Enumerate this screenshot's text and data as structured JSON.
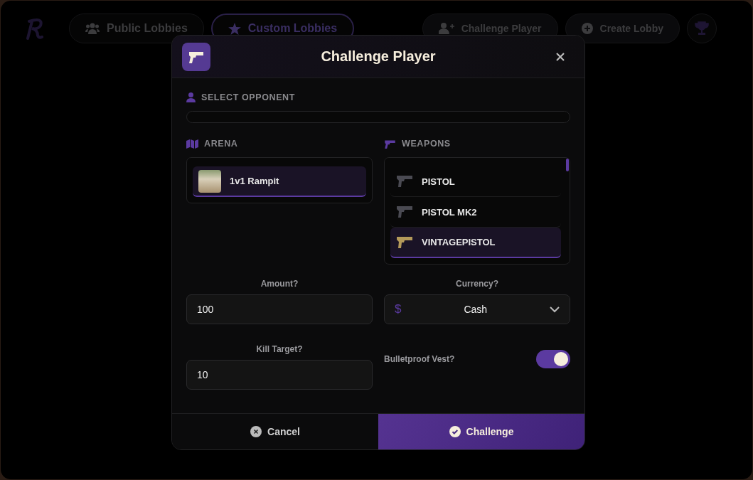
{
  "nav": {
    "tabs": [
      {
        "label": "Public Lobbies",
        "selected": false
      },
      {
        "label": "Custom Lobbies",
        "selected": true
      }
    ],
    "actions": [
      {
        "label": "Challenge Player"
      },
      {
        "label": "Create Lobby"
      }
    ]
  },
  "modal": {
    "title": "Challenge Player",
    "opponent": {
      "label": "SELECT OPPONENT"
    },
    "arena": {
      "label": "ARENA",
      "items": [
        {
          "name": "1v1 Rampit",
          "selected": true
        }
      ]
    },
    "weapons": {
      "label": "WEAPONS",
      "items": [
        {
          "name": "PISTOL",
          "selected": false
        },
        {
          "name": "PISTOL MK2",
          "selected": false
        },
        {
          "name": "VINTAGEPISTOL",
          "selected": true
        }
      ]
    },
    "amount": {
      "label": "Amount?",
      "value": "100"
    },
    "currency": {
      "label": "Currency?",
      "symbol": "$",
      "value": "Cash"
    },
    "kill_target": {
      "label": "Kill Target?",
      "value": "10"
    },
    "vest": {
      "label": "Bulletproof Vest?",
      "on": true
    },
    "buttons": [
      {
        "kind": "cancel",
        "label": "Cancel"
      },
      {
        "kind": "confirm",
        "label": "Challenge"
      }
    ]
  }
}
